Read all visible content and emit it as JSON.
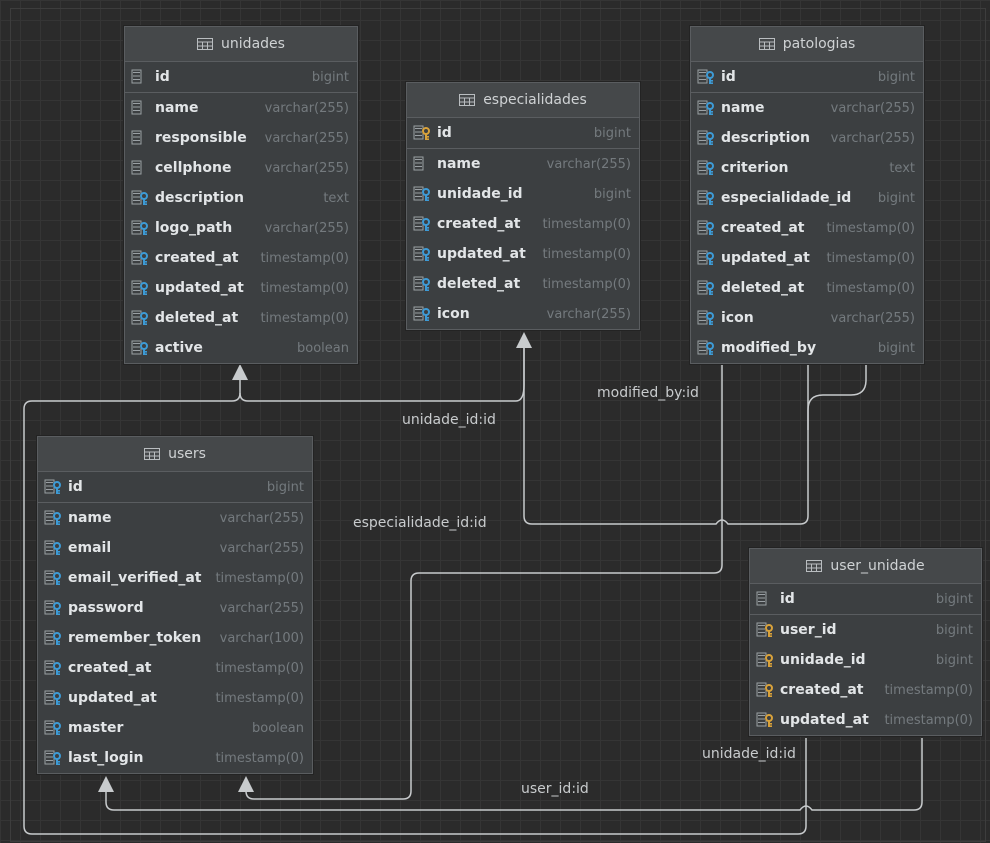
{
  "tables": [
    {
      "id": "unidades",
      "title": "unidades",
      "columns": [
        {
          "name": "id",
          "type": "bigint",
          "icon": "plain"
        },
        {
          "name": "name",
          "type": "varchar(255)",
          "icon": "plain"
        },
        {
          "name": "responsible",
          "type": "varchar(255)",
          "icon": "plain"
        },
        {
          "name": "cellphone",
          "type": "varchar(255)",
          "icon": "plain"
        },
        {
          "name": "description",
          "type": "text",
          "icon": "blue"
        },
        {
          "name": "logo_path",
          "type": "varchar(255)",
          "icon": "blue"
        },
        {
          "name": "created_at",
          "type": "timestamp(0)",
          "icon": "blue"
        },
        {
          "name": "updated_at",
          "type": "timestamp(0)",
          "icon": "blue"
        },
        {
          "name": "deleted_at",
          "type": "timestamp(0)",
          "icon": "blue"
        },
        {
          "name": "active",
          "type": "boolean",
          "icon": "blue"
        }
      ]
    },
    {
      "id": "especialidades",
      "title": "especialidades",
      "columns": [
        {
          "name": "id",
          "type": "bigint",
          "icon": "gold"
        },
        {
          "name": "name",
          "type": "varchar(255)",
          "icon": "plain"
        },
        {
          "name": "unidade_id",
          "type": "bigint",
          "icon": "blue"
        },
        {
          "name": "created_at",
          "type": "timestamp(0)",
          "icon": "blue"
        },
        {
          "name": "updated_at",
          "type": "timestamp(0)",
          "icon": "blue"
        },
        {
          "name": "deleted_at",
          "type": "timestamp(0)",
          "icon": "blue"
        },
        {
          "name": "icon",
          "type": "varchar(255)",
          "icon": "blue"
        }
      ]
    },
    {
      "id": "patologias",
      "title": "patologias",
      "columns": [
        {
          "name": "id",
          "type": "bigint",
          "icon": "blue"
        },
        {
          "name": "name",
          "type": "varchar(255)",
          "icon": "blue"
        },
        {
          "name": "description",
          "type": "varchar(255)",
          "icon": "blue"
        },
        {
          "name": "criterion",
          "type": "text",
          "icon": "blue"
        },
        {
          "name": "especialidade_id",
          "type": "bigint",
          "icon": "blue"
        },
        {
          "name": "created_at",
          "type": "timestamp(0)",
          "icon": "blue"
        },
        {
          "name": "updated_at",
          "type": "timestamp(0)",
          "icon": "blue"
        },
        {
          "name": "deleted_at",
          "type": "timestamp(0)",
          "icon": "blue"
        },
        {
          "name": "icon",
          "type": "varchar(255)",
          "icon": "blue"
        },
        {
          "name": "modified_by",
          "type": "bigint",
          "icon": "blue"
        }
      ]
    },
    {
      "id": "users",
      "title": "users",
      "columns": [
        {
          "name": "id",
          "type": "bigint",
          "icon": "blue"
        },
        {
          "name": "name",
          "type": "varchar(255)",
          "icon": "blue"
        },
        {
          "name": "email",
          "type": "varchar(255)",
          "icon": "blue"
        },
        {
          "name": "email_verified_at",
          "type": "timestamp(0)",
          "icon": "blue"
        },
        {
          "name": "password",
          "type": "varchar(255)",
          "icon": "blue"
        },
        {
          "name": "remember_token",
          "type": "varchar(100)",
          "icon": "blue"
        },
        {
          "name": "created_at",
          "type": "timestamp(0)",
          "icon": "blue"
        },
        {
          "name": "updated_at",
          "type": "timestamp(0)",
          "icon": "blue"
        },
        {
          "name": "master",
          "type": "boolean",
          "icon": "blue"
        },
        {
          "name": "last_login",
          "type": "timestamp(0)",
          "icon": "blue"
        }
      ]
    },
    {
      "id": "user_unidade",
      "title": "user_unidade",
      "columns": [
        {
          "name": "id",
          "type": "bigint",
          "icon": "plain"
        },
        {
          "name": "user_id",
          "type": "bigint",
          "icon": "gold"
        },
        {
          "name": "unidade_id",
          "type": "bigint",
          "icon": "gold"
        },
        {
          "name": "created_at",
          "type": "timestamp(0)",
          "icon": "gold"
        },
        {
          "name": "updated_at",
          "type": "timestamp(0)",
          "icon": "gold"
        }
      ]
    }
  ],
  "relations": [
    {
      "id": "rel-unidade",
      "label": "unidade_id:id"
    },
    {
      "id": "rel-modified",
      "label": "modified_by:id"
    },
    {
      "id": "rel-especialidade",
      "label": "especialidade_id:id"
    },
    {
      "id": "rel-user-unidade",
      "label": "unidade_id:id"
    },
    {
      "id": "rel-user",
      "label": "user_id:id"
    }
  ],
  "colors": {
    "background": "#2b2b2b",
    "table": "#3c3f41",
    "edge": "#c8cbcd",
    "key_blue": "#3d9bd6",
    "key_gold": "#d9a23a"
  },
  "icon_names": {
    "table": "table-grid-icon",
    "plain": "column-icon",
    "blue": "column-key-icon",
    "gold": "column-fk-icon"
  }
}
